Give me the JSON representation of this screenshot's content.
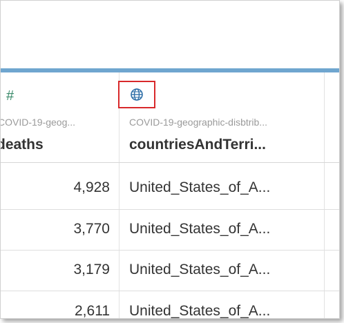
{
  "columns": [
    {
      "type_icon": "number-hash-icon",
      "source": "COVID-19-geog...",
      "name": "deaths"
    },
    {
      "type_icon": "globe-icon",
      "source": "COVID-19-geographic-disbtrib...",
      "name": "countriesAndTerri..."
    }
  ],
  "rows": [
    {
      "deaths": "4,928",
      "country": "United_States_of_A..."
    },
    {
      "deaths": "3,770",
      "country": "United_States_of_A..."
    },
    {
      "deaths": "3,179",
      "country": "United_States_of_A..."
    },
    {
      "deaths": "2,611",
      "country": "United_States_of_A..."
    }
  ],
  "colors": {
    "accent_bar": "#6fa6cf",
    "highlight_box": "#d8282a",
    "number_icon": "#3a8a6a",
    "globe_icon": "#2f6fa8"
  }
}
